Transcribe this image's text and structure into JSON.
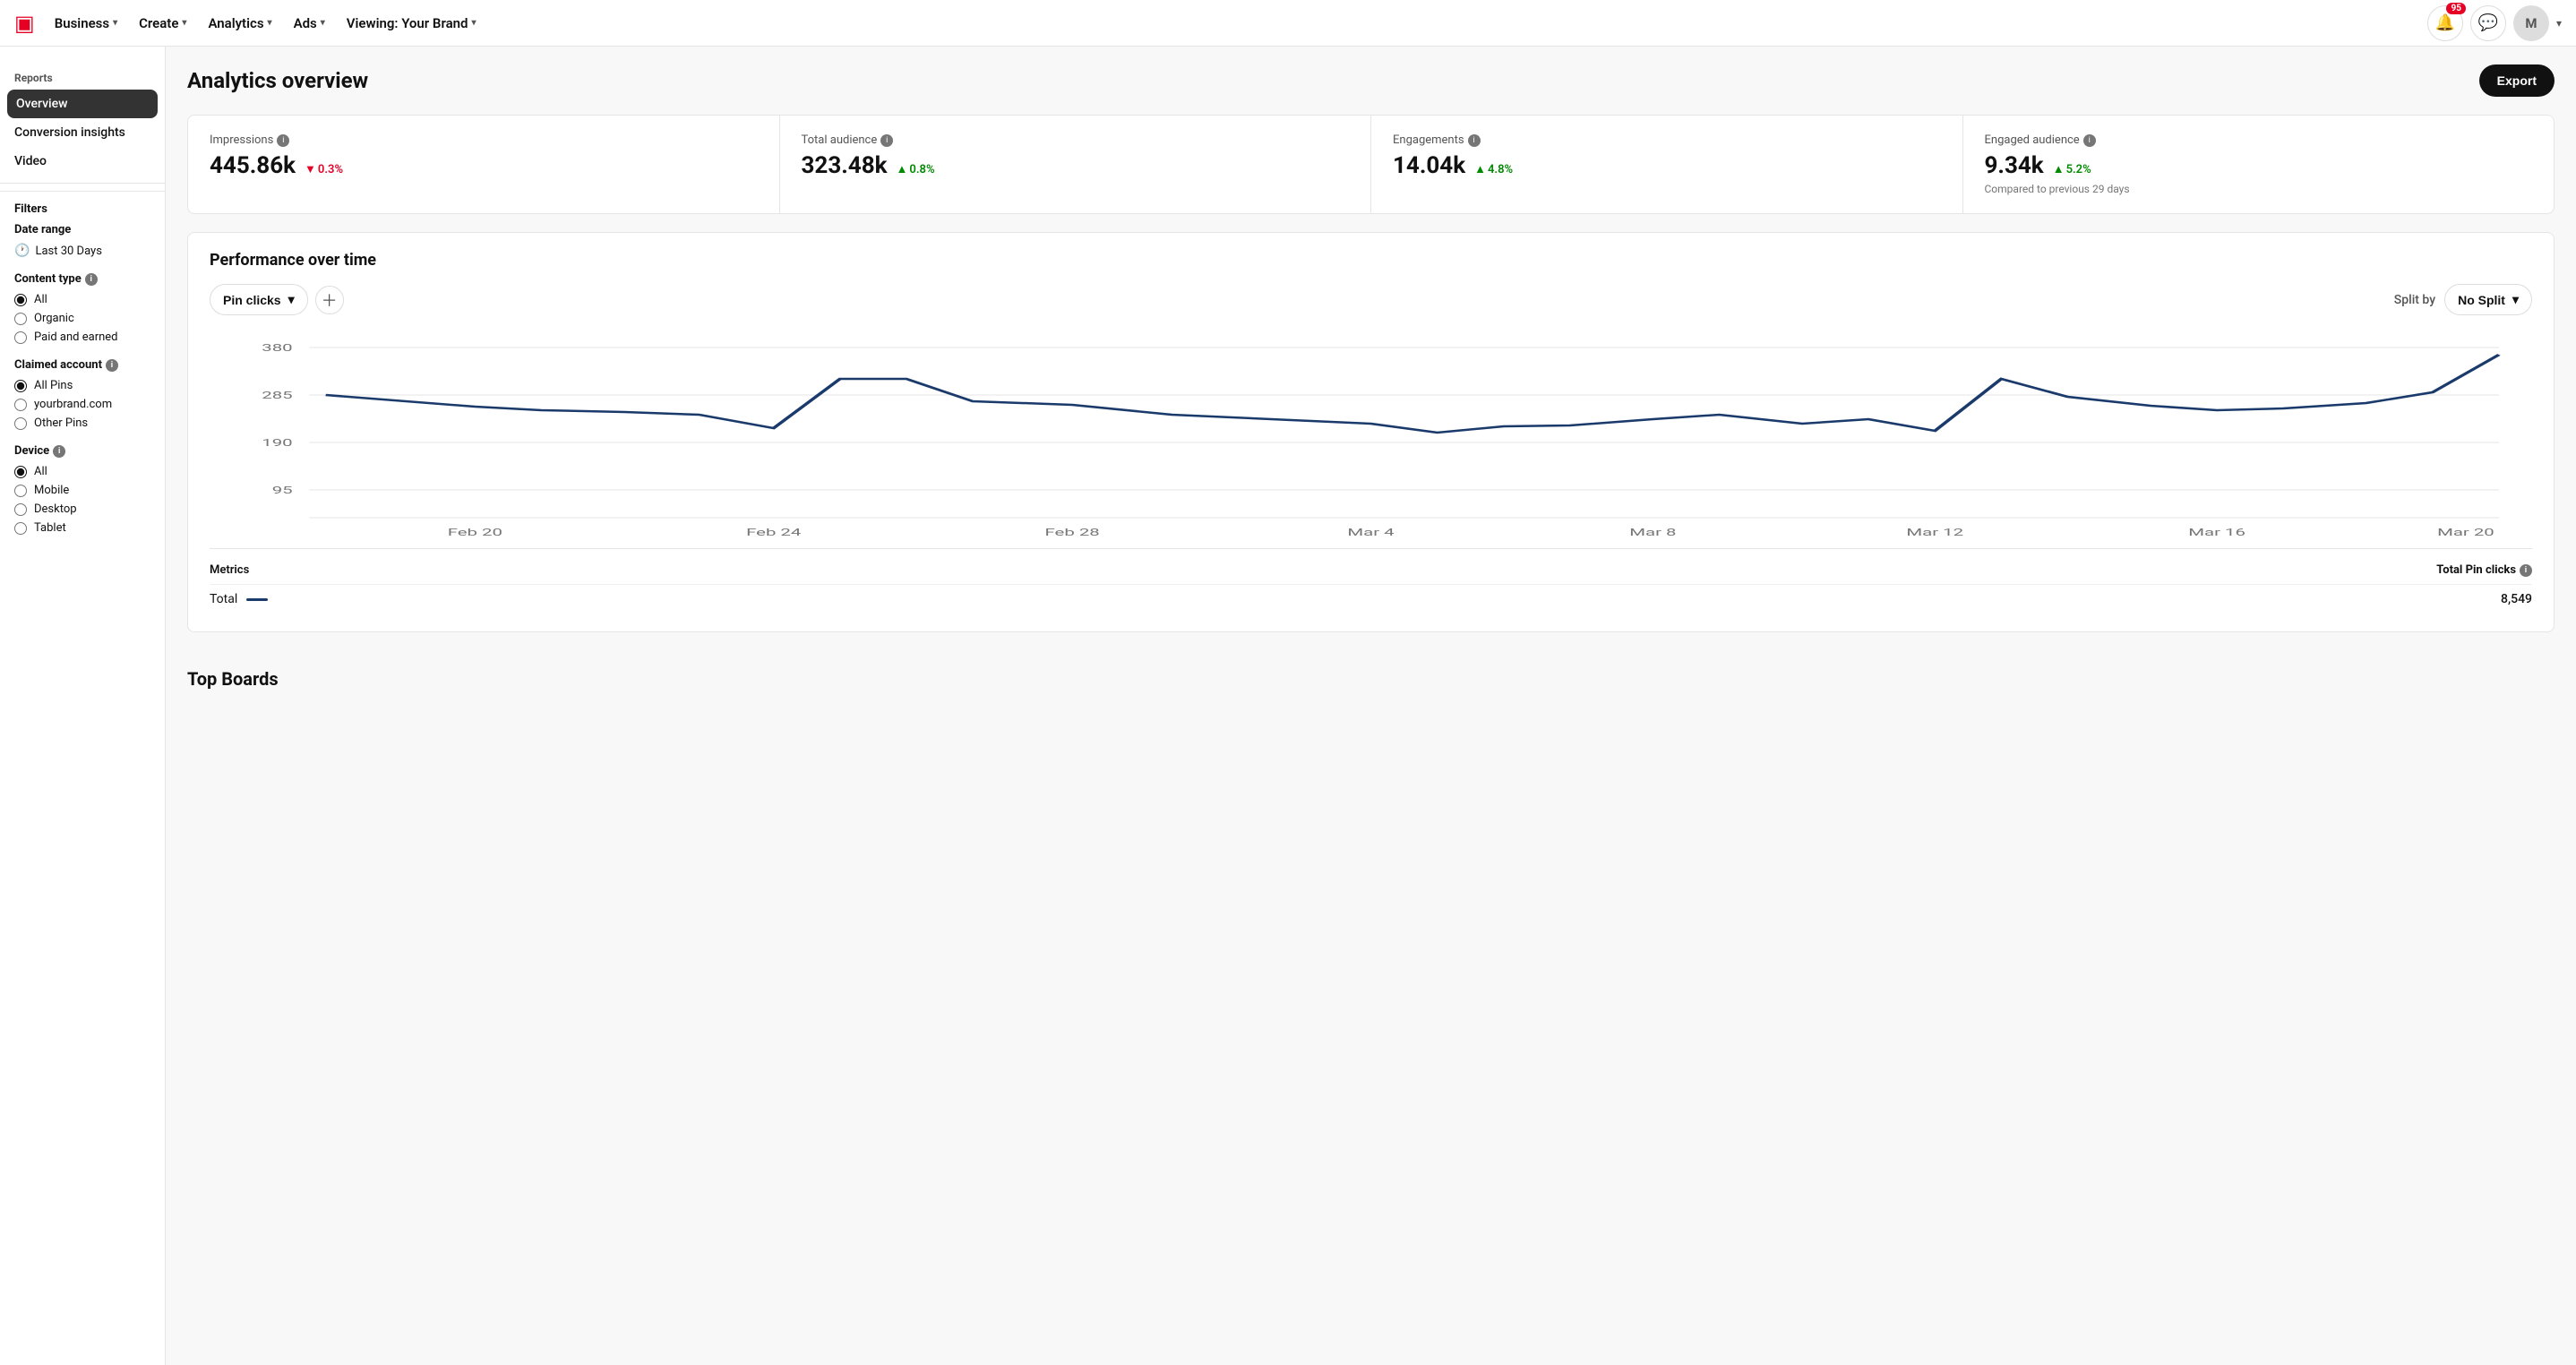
{
  "topnav": {
    "logo": "P",
    "items": [
      {
        "label": "Business",
        "has_chevron": true
      },
      {
        "label": "Create",
        "has_chevron": true
      },
      {
        "label": "Analytics",
        "has_chevron": true
      },
      {
        "label": "Ads",
        "has_chevron": true
      },
      {
        "label": "Viewing: Your Brand",
        "has_chevron": true
      }
    ],
    "notification_count": "95",
    "avatar_letter": "M"
  },
  "page": {
    "title": "Analytics overview",
    "export_label": "Export"
  },
  "sidebar": {
    "reports_label": "Reports",
    "nav_items": [
      {
        "label": "Overview",
        "active": true
      },
      {
        "label": "Conversion insights"
      },
      {
        "label": "Video"
      }
    ],
    "filters_label": "Filters",
    "date_range": {
      "label": "Date range",
      "value": "Last 30 Days"
    },
    "content_type": {
      "label": "Content type",
      "options": [
        "All",
        "Organic",
        "Paid and earned"
      ],
      "selected": "All"
    },
    "claimed_account": {
      "label": "Claimed account",
      "options": [
        "All Pins",
        "yourbrand.com",
        "Other Pins"
      ],
      "selected": "All Pins"
    },
    "device": {
      "label": "Device",
      "options": [
        "All",
        "Mobile",
        "Desktop",
        "Tablet"
      ],
      "selected": "All"
    }
  },
  "stats": [
    {
      "label": "Impressions",
      "value": "445.86k",
      "change": "0.3%",
      "direction": "down"
    },
    {
      "label": "Total audience",
      "value": "323.48k",
      "change": "0.8%",
      "direction": "up"
    },
    {
      "label": "Engagements",
      "value": "14.04k",
      "change": "4.8%",
      "direction": "up"
    },
    {
      "label": "Engaged audience",
      "value": "9.34k",
      "change": "5.2%",
      "direction": "up",
      "note": "Compared to previous 29 days"
    }
  ],
  "chart": {
    "title": "Performance over time",
    "metric_dropdown": "Pin clicks",
    "split_label": "Split by",
    "split_value": "No Split",
    "y_labels": [
      "380",
      "285",
      "190",
      "95"
    ],
    "x_labels": [
      "Feb 20",
      "Feb 24",
      "Feb 28",
      "Mar 4",
      "Mar 8",
      "Mar 12",
      "Mar 16",
      "Mar 20"
    ],
    "metrics_col": "Metrics",
    "total_pin_clicks_label": "Total Pin clicks",
    "total_row_label": "Total",
    "total_value": "8,549"
  },
  "top_boards": {
    "title": "Top Boards"
  }
}
